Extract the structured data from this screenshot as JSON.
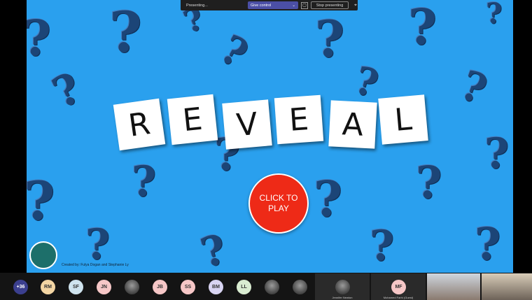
{
  "toolbar": {
    "presenting_label": "Presenting...",
    "give_control_label": "Give control",
    "stop_presenting_label": "Stop presenting"
  },
  "slide": {
    "tiles": [
      "R",
      "E",
      "V",
      "E",
      "A",
      "L"
    ],
    "play_button_label": "CLICK TO PLAY",
    "credit": "Created by: Fulya Dogan and Stephanie Ly"
  },
  "participants": {
    "overflow_count": "+36",
    "initials": [
      "RM",
      "SF",
      "JN",
      "JB",
      "SS",
      "BM",
      "LL"
    ],
    "video_tiles": [
      {
        "name": "Jennifer Newton"
      },
      {
        "initials": "MF",
        "name": "Mohamed Farhi (Guest)"
      }
    ]
  },
  "colors": {
    "slide_background": "#2aa0ee",
    "play_button": "#ee2a17",
    "give_control": "#4b4fa6"
  }
}
